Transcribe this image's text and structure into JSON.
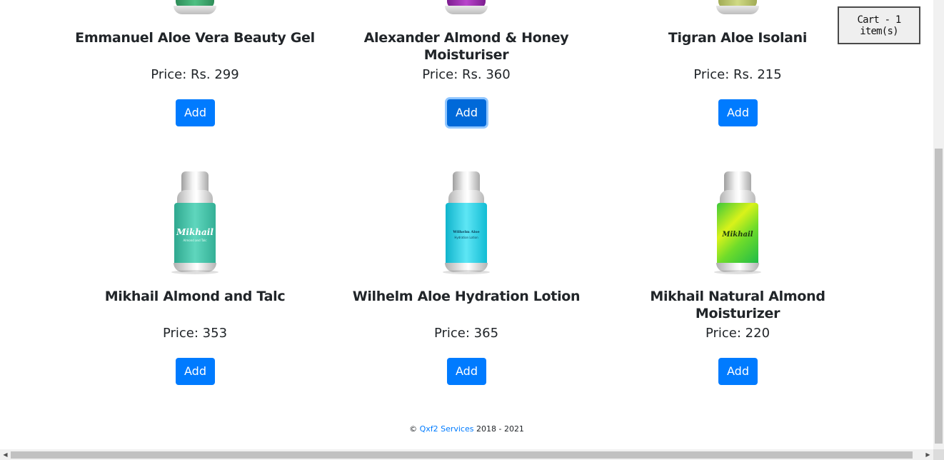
{
  "cart": {
    "label": "Cart - 1 item(s)"
  },
  "products": [
    {
      "name": "Emmanuel Aloe Vera Beauty Gel",
      "price": "Price: Rs. 299",
      "add_label": "Add",
      "bottle_color": "#3aa66b"
    },
    {
      "name": "Alexander Almond & Honey Moisturiser",
      "price": "Price: Rs. 360",
      "add_label": "Add",
      "bottle_color": "#9b27b0"
    },
    {
      "name": "Tigran Aloe Isolani",
      "price": "Price: Rs. 215",
      "add_label": "Add",
      "bottle_color": "#b8c46a"
    },
    {
      "name": "Mikhail Almond and Talc",
      "price": "Price: 353",
      "add_label": "Add",
      "bottle_color": "#3fc4a8",
      "bottle_label": "Mikhail",
      "bottle_sub": "Almond and Talc"
    },
    {
      "name": "Wilhelm Aloe Hydration Lotion",
      "price": "Price: 365",
      "add_label": "Add",
      "bottle_color": "#1ccfe6",
      "bottle_label": "Wilhelm Aloe",
      "bottle_sub": "Hydration Lotion"
    },
    {
      "name": "Mikhail Natural Almond Moisturizer",
      "price": "Price: 220",
      "add_label": "Add",
      "bottle_color": "#9de22a",
      "bottle_label": "Mikhail"
    }
  ],
  "footer": {
    "copyright": "©",
    "link_text": "Qxf2 Services",
    "years": "2018 - 2021"
  },
  "colors": {
    "primary": "#007bff",
    "primary_focused": "#0069d9"
  }
}
